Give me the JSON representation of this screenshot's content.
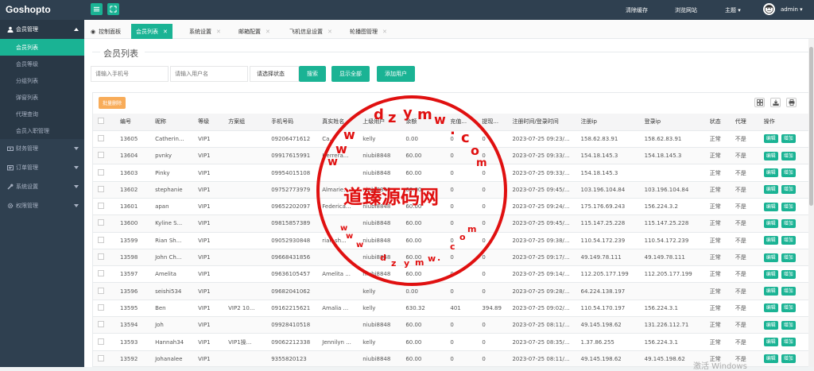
{
  "app": {
    "brand": "Goshopto"
  },
  "topbar": {
    "links": [
      "清除缓存",
      "浏览网站",
      "主题"
    ],
    "user": "admin"
  },
  "sidebar": {
    "groups": [
      {
        "label": "会员管理",
        "icon": "user-icon"
      },
      {
        "label": "财务管理",
        "icon": "money-icon"
      },
      {
        "label": "订单管理",
        "icon": "cart-icon"
      },
      {
        "label": "系统设置",
        "icon": "wrench-icon"
      },
      {
        "label": "权限管理",
        "icon": "gear-icon"
      }
    ],
    "items": [
      "会员列表",
      "会员等级",
      "分组列表",
      "弹窗列表",
      "代理查询",
      "会员入职管理"
    ]
  },
  "tabs": [
    "控制面板",
    "会员列表",
    "系统设置",
    "邮箱配置",
    "飞机信息设置",
    "轮播图管理"
  ],
  "page": {
    "title": "会员列表",
    "phone_placeholder": "请输入手机号",
    "user_placeholder": "请输入用户名",
    "status_select": "请选择状态",
    "search_btn": "搜索",
    "show_all_btn": "显示全部",
    "add_user_btn": "添加用户",
    "batch_delete": "批量删除"
  },
  "table": {
    "headers": [
      "",
      "编号",
      "昵称",
      "等级",
      "方案组",
      "手机号码",
      "真实姓名",
      "上级用户",
      "余额",
      "充值...",
      "提现...",
      "注册时间/登录时间",
      "注册ip",
      "登录ip",
      "状态",
      "代理",
      "操作"
    ],
    "rows": [
      [
        "13605",
        "Catherin...",
        "VIP1",
        "",
        "09206471612",
        "Ca...",
        "kelly",
        "0.00",
        "0",
        "0",
        "2023-07-25 09:23/...",
        "158.62.83.91",
        "158.62.83.91",
        "正常",
        "不是"
      ],
      [
        "13604",
        "pvnky",
        "VIP1",
        "",
        "09917615991",
        "Herrera...",
        "niubi8848",
        "60.00",
        "0",
        "0",
        "2023-07-25 09:33/...",
        "154.18.145.3",
        "154.18.145.3",
        "正常",
        "不是"
      ],
      [
        "13603",
        "Pinky",
        "VIP1",
        "",
        "09954015108",
        "",
        "niubi8848",
        "60.00",
        "0",
        "0",
        "2023-07-25 09:33/...",
        "154.18.145.3",
        "",
        "正常",
        "不是"
      ],
      [
        "13602",
        "stephanie",
        "VIP1",
        "",
        "09752773979",
        "Almarie...",
        "niubi8848",
        "60.00",
        "0",
        "0",
        "2023-07-25 09:45/...",
        "103.196.104.84",
        "103.196.104.84",
        "正常",
        "不是"
      ],
      [
        "13601",
        "apan",
        "VIP1",
        "",
        "09652202097",
        "Federica...",
        "niubi8848",
        "60.00",
        "0",
        "0",
        "2023-07-25 09:24/...",
        "175.176.69.243",
        "156.224.3.2",
        "正常",
        "不是"
      ],
      [
        "13600",
        "Kyline S...",
        "VIP1",
        "",
        "09815857389",
        "",
        "niubi8848",
        "60.00",
        "0",
        "0",
        "2023-07-25 09:45/...",
        "115.147.25.228",
        "115.147.25.228",
        "正常",
        "不是"
      ],
      [
        "13599",
        "Rian Sh...",
        "VIP1",
        "",
        "09052930848",
        "rian sh...",
        "niubi8848",
        "60.00",
        "0",
        "0",
        "2023-07-25 09:38/...",
        "110.54.172.239",
        "110.54.172.239",
        "正常",
        "不是"
      ],
      [
        "13598",
        "John Ch...",
        "VIP1",
        "",
        "09668431856",
        "",
        "niubi8848",
        "60.00",
        "0",
        "0",
        "2023-07-25 09:17/...",
        "49.149.78.111",
        "49.149.78.111",
        "正常",
        "不是"
      ],
      [
        "13597",
        "Amelita",
        "VIP1",
        "",
        "09636105457",
        "Amelita ...",
        "niubi8848",
        "60.00",
        "0",
        "0",
        "2023-07-25 09:14/...",
        "112.205.177.199",
        "112.205.177.199",
        "正常",
        "不是"
      ],
      [
        "13596",
        "seishi534",
        "VIP1",
        "",
        "09682041062",
        "",
        "kelly",
        "0.00",
        "0",
        "0",
        "2023-07-25 09:28/...",
        "64.224.138.197",
        "",
        "正常",
        "不是"
      ],
      [
        "13595",
        "Ben",
        "VIP1",
        "VIP2 10...",
        "09162215621",
        "Amalia ...",
        "kelly",
        "630.32",
        "401",
        "394.89",
        "2023-07-25 09:02/...",
        "110.54.170.197",
        "156.224.3.1",
        "正常",
        "不是"
      ],
      [
        "13594",
        "Joh",
        "VIP1",
        "",
        "09928410518",
        "",
        "niubi8848",
        "60.00",
        "0",
        "0",
        "2023-07-25 08:11/...",
        "49.145.198.62",
        "131.226.112.71",
        "正常",
        "不是"
      ],
      [
        "13593",
        "Hannah34",
        "VIP1",
        "VIP1操...",
        "09062212338",
        "Jennilyn ...",
        "kelly",
        "60.00",
        "0",
        "0",
        "2023-07-25 08:35/...",
        "1.37.86.255",
        "156.224.3.1",
        "正常",
        "不是"
      ],
      [
        "13592",
        "Johanalee",
        "VIP1",
        "",
        "9355820123",
        "",
        "niubi8848",
        "60.00",
        "0",
        "0",
        "2023-07-25 08:11/...",
        "49.145.198.62",
        "49.145.198.62",
        "正常",
        "不是"
      ]
    ],
    "action_edit": "编辑",
    "action_add": "增加"
  },
  "watermark": {
    "stamp": "道臻源码网",
    "chars": [
      "d",
      "z",
      "y",
      "m",
      "w",
      ".",
      "c",
      "o",
      "m"
    ],
    "os_tag": "激活 Windows"
  },
  "colors": {
    "accent": "#1ab394",
    "sidebar": "#2f4050",
    "warning": "#f8ac59",
    "stamp": "#e01010"
  }
}
